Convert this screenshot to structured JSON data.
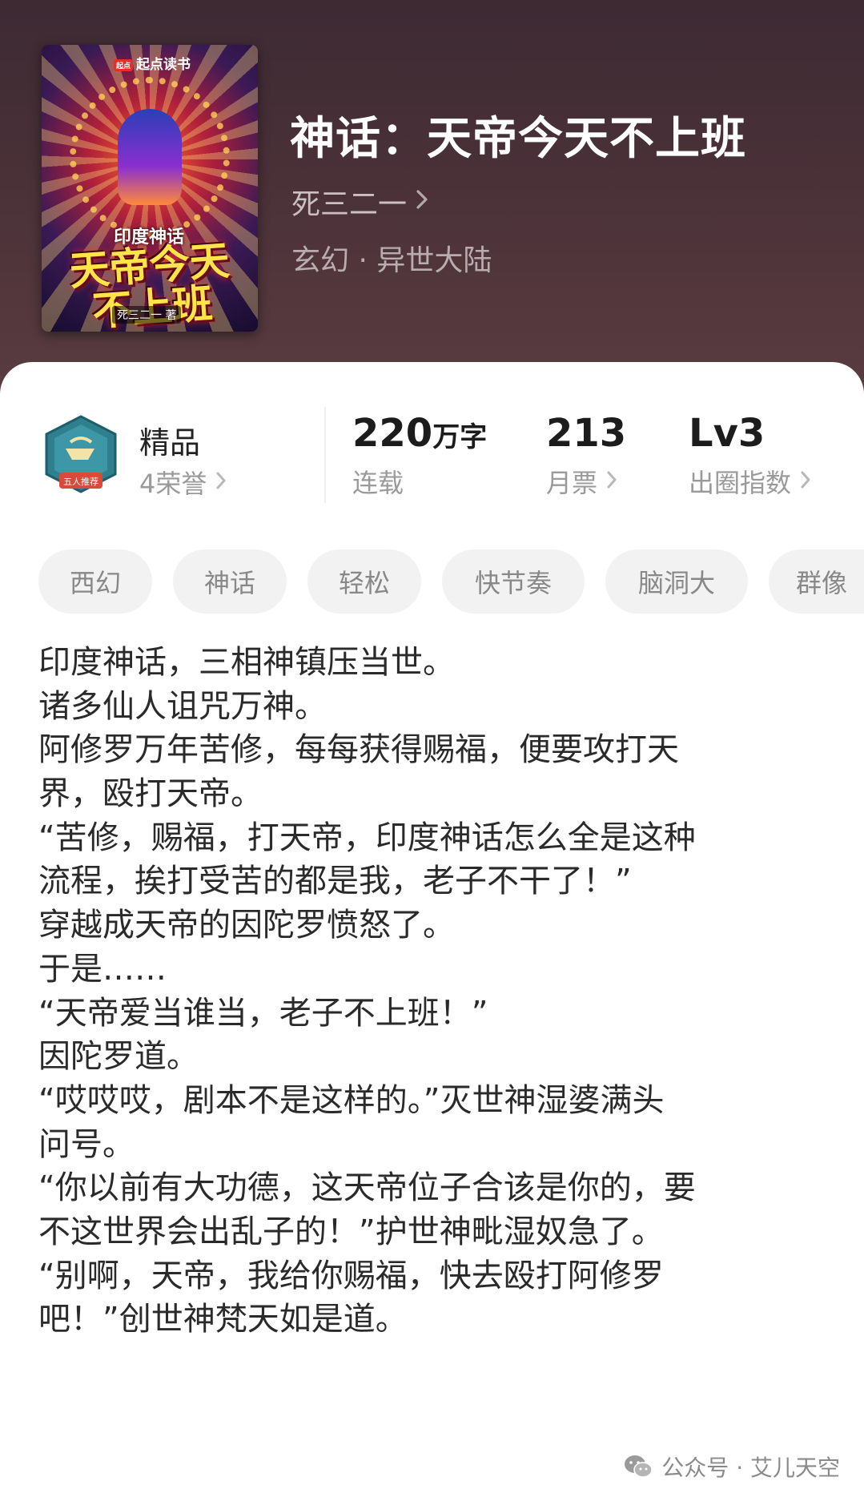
{
  "header": {
    "cover": {
      "brand": "起点读书",
      "brand_mark": "起点",
      "tag": "印度神话",
      "title_art": "天帝今天不上班",
      "author_art": "死三二一 著"
    },
    "title": "神话：天帝今天不上班",
    "author": "死三二一",
    "genre": "玄幻 · 异世大陆"
  },
  "stats": {
    "quality": {
      "label": "精品",
      "sub": "4荣誉",
      "badge_text": "五人推荐"
    },
    "words": {
      "value": "220",
      "unit": "万字",
      "label": "连载"
    },
    "tickets": {
      "value": "213",
      "label": "月票"
    },
    "level": {
      "value": "Lv3",
      "label": "出圈指数"
    }
  },
  "tags": [
    "西幻",
    "神话",
    "轻松",
    "快节奏",
    "脑洞大",
    "群像"
  ],
  "synopsis": [
    "印度神话，三相神镇压当世。",
    "诸多仙人诅咒万神。",
    "阿修罗万年苦修，每每获得赐福，便要攻打天",
    "界，殴打天帝。",
    "“苦修，赐福，打天帝，印度神话怎么全是这种",
    "流程，挨打受苦的都是我，老子不干了！”",
    "穿越成天帝的因陀罗愤怒了。",
    "于是……",
    "“天帝爱当谁当，老子不上班！”",
    "因陀罗道。",
    "“哎哎哎，剧本不是这样的。”灭世神湿婆满头",
    "问号。",
    "“你以前有大功德，这天帝位子合该是你的，要",
    "不这世界会出乱子的！”护世神毗湿奴急了。",
    "“别啊，天帝，我给你赐福，快去殴打阿修罗",
    "吧！”创世神梵天如是道。"
  ],
  "watermark": "公众号 · 艾儿天空",
  "colors": {
    "header_bg": "#4a3138",
    "title": "#ffffff",
    "tag_bg": "#f2f2f2",
    "tag_text": "#888888",
    "body_text": "#2a2a2a",
    "muted": "#9a9a9a"
  }
}
